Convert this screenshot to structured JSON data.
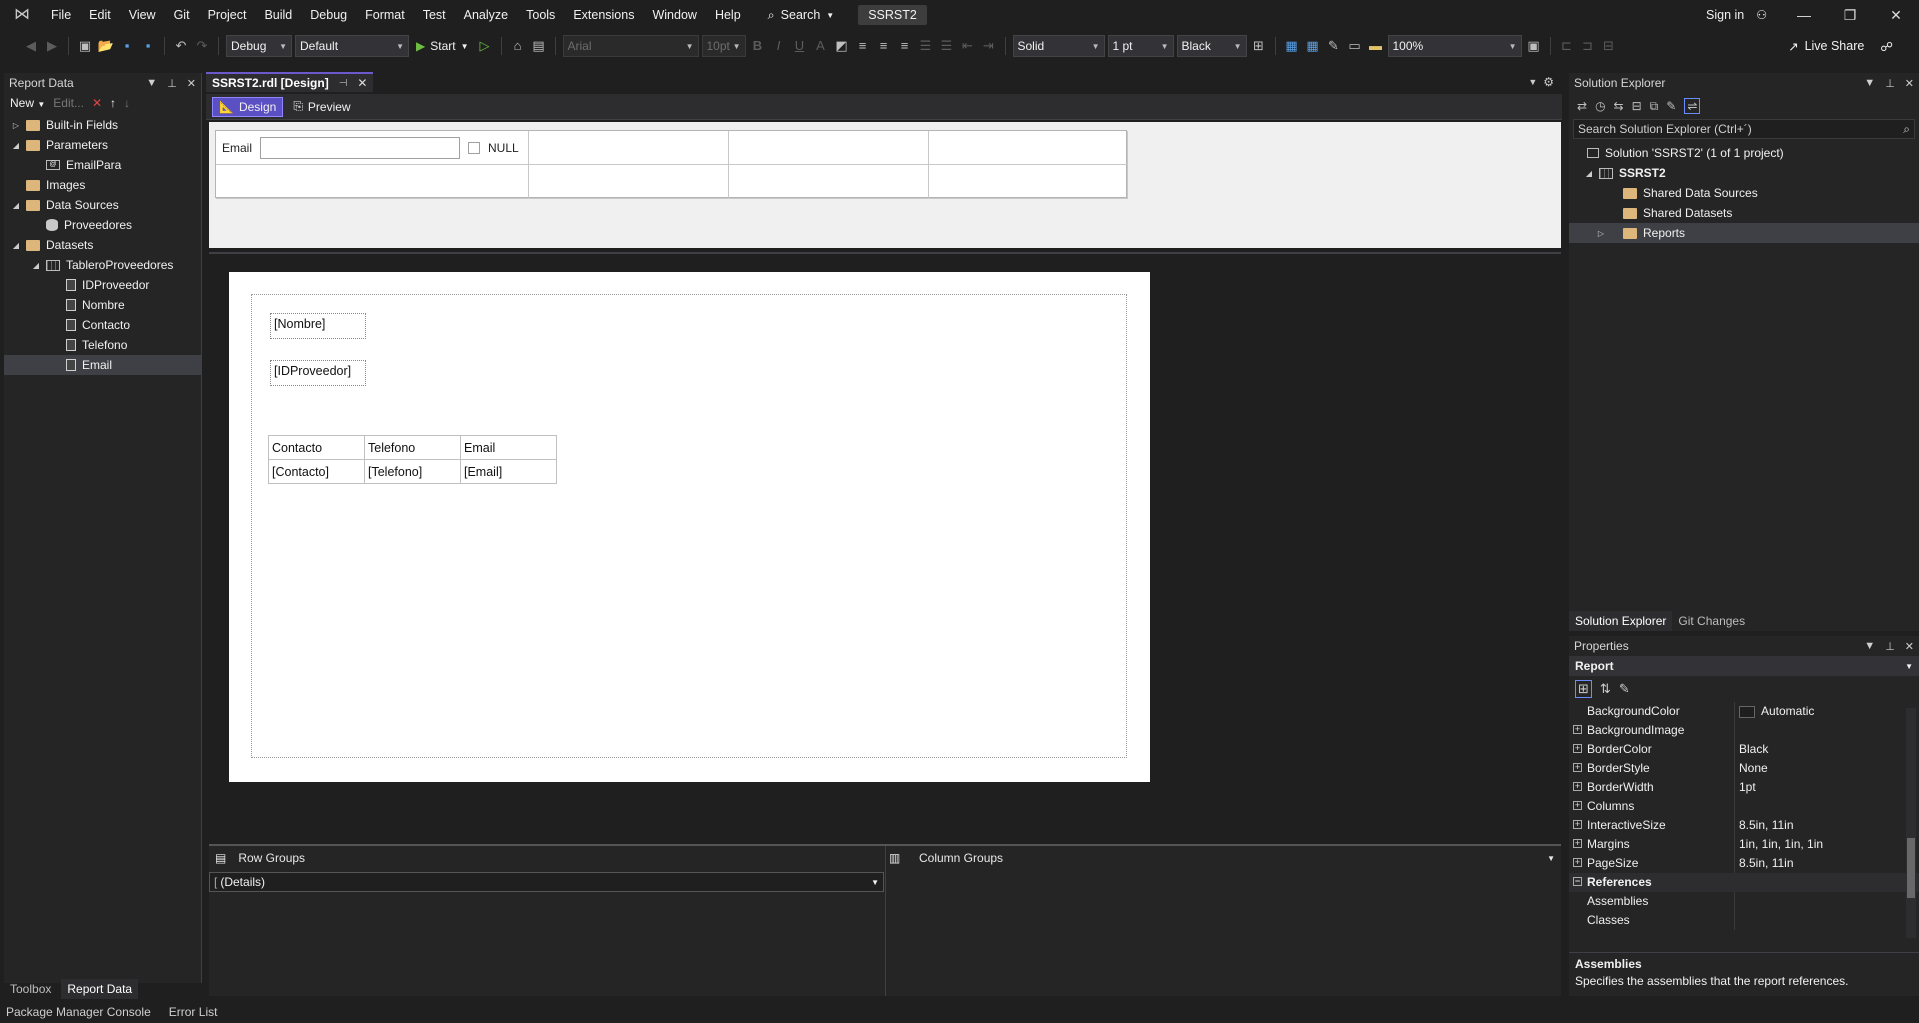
{
  "menu": [
    "File",
    "Edit",
    "View",
    "Git",
    "Project",
    "Build",
    "Debug",
    "Format",
    "Test",
    "Analyze",
    "Tools",
    "Extensions",
    "Window",
    "Help"
  ],
  "search_label": "Search",
  "solution_name": "SSRST2",
  "sign_in": "Sign in",
  "toolbar": {
    "config": "Debug",
    "platform": "Default",
    "start": "Start",
    "font": "Arial",
    "font_size": "10pt",
    "border_style": "Solid",
    "border_width": "1 pt",
    "border_color": "Black",
    "zoom": "100%",
    "live_share": "Live Share"
  },
  "report_data": {
    "title": "Report Data",
    "new_label": "New",
    "edit_label": "Edit...",
    "items": [
      {
        "label": "Built-in Fields",
        "depth": 0,
        "twisty": "▷",
        "icon": "folder"
      },
      {
        "label": "Parameters",
        "depth": 0,
        "twisty": "◢",
        "icon": "folder"
      },
      {
        "label": "EmailPara",
        "depth": 1,
        "twisty": "",
        "icon": "param"
      },
      {
        "label": "Images",
        "depth": 0,
        "twisty": "",
        "icon": "folder"
      },
      {
        "label": "Data Sources",
        "depth": 0,
        "twisty": "◢",
        "icon": "folder"
      },
      {
        "label": "Proveedores",
        "depth": 1,
        "twisty": "",
        "icon": "db"
      },
      {
        "label": "Datasets",
        "depth": 0,
        "twisty": "◢",
        "icon": "folder"
      },
      {
        "label": "TableroProveedores",
        "depth": 1,
        "twisty": "◢",
        "icon": "grid"
      },
      {
        "label": "IDProveedor",
        "depth": 2,
        "twisty": "",
        "icon": "field"
      },
      {
        "label": "Nombre",
        "depth": 2,
        "twisty": "",
        "icon": "field"
      },
      {
        "label": "Contacto",
        "depth": 2,
        "twisty": "",
        "icon": "field"
      },
      {
        "label": "Telefono",
        "depth": 2,
        "twisty": "",
        "icon": "field"
      },
      {
        "label": "Email",
        "depth": 2,
        "twisty": "",
        "icon": "field",
        "selected": true
      }
    ],
    "bottom_tabs": [
      "Toolbox",
      "Report Data"
    ]
  },
  "document": {
    "tab_title": "SSRST2.rdl [Design]",
    "design_tab": "Design",
    "preview_tab": "Preview",
    "param_label": "Email",
    "null_label": "NULL"
  },
  "report": {
    "nombre_box": "[Nombre]",
    "id_box": "[IDProveedor]",
    "table_header": [
      "Contacto",
      "Telefono",
      "Email"
    ],
    "table_row": [
      "[Contacto]",
      "[Telefono]",
      "[Email]"
    ]
  },
  "groups": {
    "row_groups": "Row Groups",
    "column_groups": "Column Groups",
    "details": "(Details)"
  },
  "solution_explorer": {
    "title": "Solution Explorer",
    "search_placeholder": "Search Solution Explorer (Ctrl+´)",
    "solution": "Solution 'SSRST2' (1 of 1 project)",
    "project": "SSRST2",
    "folders": [
      "Shared Data Sources",
      "Shared Datasets",
      "Reports"
    ],
    "tabs": [
      "Solution Explorer",
      "Git Changes"
    ]
  },
  "properties": {
    "title": "Properties",
    "object": "Report",
    "rows": [
      {
        "name": "BackgroundColor",
        "value": "Automatic",
        "expand": false,
        "swatch": true
      },
      {
        "name": "BackgroundImage",
        "value": "",
        "expand": true
      },
      {
        "name": "BorderColor",
        "value": "Black",
        "expand": true
      },
      {
        "name": "BorderStyle",
        "value": "None",
        "expand": true
      },
      {
        "name": "BorderWidth",
        "value": "1pt",
        "expand": true
      },
      {
        "name": "Columns",
        "value": "",
        "expand": true
      },
      {
        "name": "InteractiveSize",
        "value": "8.5in, 11in",
        "expand": true
      },
      {
        "name": "Margins",
        "value": "1in, 1in, 1in, 1in",
        "expand": true
      },
      {
        "name": "PageSize",
        "value": "8.5in, 11in",
        "expand": true
      }
    ],
    "category": "References",
    "sub_rows": [
      "Assemblies",
      "Classes"
    ],
    "desc_title": "Assemblies",
    "desc_text": "Specifies the assemblies that the report references."
  },
  "statusbar": [
    "Package Manager Console",
    "Error List"
  ]
}
